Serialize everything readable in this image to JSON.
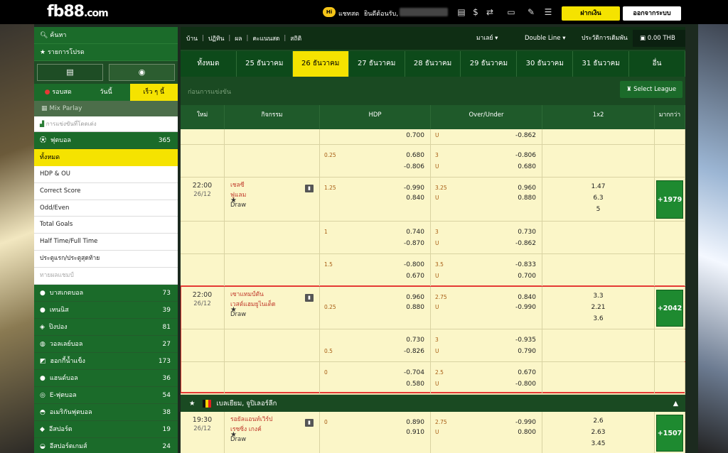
{
  "header": {
    "logo_main": "fb88",
    "logo_suffix": ".com",
    "chat_label": "แชทสด",
    "chat_badge": "Hi",
    "welcome": "ยินดีต้อนรับ,",
    "deposit_button": "ฝากเงิน",
    "logout_button": "ออกจากระบบ"
  },
  "sidebar": {
    "search": "ค้นหา",
    "favorites": "รายการโปรด",
    "tabs": [
      "รอบสด",
      "วันนี้",
      "เร็ว ๆ นี้"
    ],
    "mix_parlay": "Mix Parlay",
    "combo": "การแข่งขันที่โดดเด่ง",
    "football": {
      "label": "ฟุตบอล",
      "count": "365"
    },
    "all": "ทั้งหมด",
    "subs": [
      "HDP & OU",
      "Correct Score",
      "Odd/Even",
      "Total Goals",
      "Half Time/Full Time",
      "ประตูแรก/ประตูสุดท้าย",
      "ทายผลแชมป์"
    ],
    "sports": [
      {
        "label": "บาสเกตบอล",
        "count": "73"
      },
      {
        "label": "เทนนิส",
        "count": "39"
      },
      {
        "label": "ปิงปอง",
        "count": "81"
      },
      {
        "label": "วอลเลย์บอล",
        "count": "27"
      },
      {
        "label": "ฮอกกี้น้ำแข็ง",
        "count": "173"
      },
      {
        "label": "แฮนด์บอล",
        "count": "36"
      },
      {
        "label": "E-ฟุตบอล",
        "count": "54"
      },
      {
        "label": "อเมริกันฟุตบอล",
        "count": "38"
      },
      {
        "label": "อีสปอร์ต",
        "count": "19"
      },
      {
        "label": "อีสปอร์ตเกมส์",
        "count": "24"
      }
    ]
  },
  "nav": {
    "links": [
      "บ้าน",
      "ปฏิทิน",
      "ผล",
      "คะแนนสด",
      "สถิติ"
    ],
    "odds_type": "มาเลย์",
    "line": "Double Line",
    "history": "ประวัติการเดิมพัน",
    "balance": "0.00 THB"
  },
  "date_tabs": [
    "ทั้งหมด",
    "25 ธันวาคม",
    "26 ธันวาคม",
    "27 ธันวาคม",
    "28 ธันวาคม",
    "29 ธันวาคม",
    "30 ธันวาคม",
    "31 ธันวาคม",
    "อื่น"
  ],
  "section_title": "ก่อนการแข่งขัน",
  "select_league": "Select League",
  "columns": [
    "ใหม่",
    "กิจกรรม",
    "HDP",
    "Over/Under",
    "1x2",
    "มากกว่า"
  ],
  "rows": [
    {
      "h": 22,
      "hdp": {
        "l1": "",
        "v1": "0.700",
        "l2": "",
        "v2": ""
      },
      "ou": {
        "l1": "U",
        "v1": "-0.862",
        "l2": "",
        "v2": ""
      }
    },
    {
      "h": 46,
      "hdp": {
        "l1": "0.25",
        "v1": "0.680",
        "l2": "",
        "v2": "-0.806"
      },
      "ou": {
        "l1": "3",
        "v1": "-0.806",
        "l2": "U",
        "v2": "0.680"
      }
    },
    {
      "h": 62,
      "time": "22:00",
      "date": "26/12",
      "home": "เชลซี",
      "away": "ฟูแลม",
      "draw": "Draw",
      "hdp": {
        "l1": "1.25",
        "v1": "-0.990",
        "l2": "",
        "v2": "0.840"
      },
      "ou": {
        "l1": "3.25",
        "v1": "0.960",
        "l2": "U",
        "v2": "0.880"
      },
      "x12": [
        "1.47",
        "6.3",
        "5"
      ],
      "more": "+1979"
    },
    {
      "h": 46,
      "hdp": {
        "l1": "1",
        "v1": "0.740",
        "l2": "",
        "v2": "-0.870"
      },
      "ou": {
        "l1": "3",
        "v1": "0.730",
        "l2": "U",
        "v2": "-0.862"
      }
    },
    {
      "h": 46,
      "hdp": {
        "l1": "1.5",
        "v1": "-0.800",
        "l2": "",
        "v2": "0.670"
      },
      "ou": {
        "l1": "3.5",
        "v1": "-0.833",
        "l2": "U",
        "v2": "0.700"
      }
    },
    {
      "h": 60,
      "time": "22:00",
      "date": "26/12",
      "home": "เซาแทมป์ตัน",
      "away": "เวสต์แฮมยูไนเต็ด",
      "draw": "Draw",
      "hdp": {
        "l1": "",
        "v1": "0.960",
        "l2": "0.25",
        "v2": "0.880"
      },
      "ou": {
        "l1": "2.75",
        "v1": "0.840",
        "l2": "U",
        "v2": "-0.990"
      },
      "x12": [
        "3.3",
        "2.21",
        "3.6"
      ],
      "more": "+2042"
    },
    {
      "h": 46,
      "hdp": {
        "l1": "",
        "v1": "0.730",
        "l2": "0.5",
        "v2": "-0.826"
      },
      "ou": {
        "l1": "3",
        "v1": "-0.935",
        "l2": "U",
        "v2": "0.790"
      }
    },
    {
      "h": 46,
      "hdp": {
        "l1": "0",
        "v1": "-0.704",
        "l2": "",
        "v2": "0.580"
      },
      "ou": {
        "l1": "2.5",
        "v1": "0.670",
        "l2": "U",
        "v2": "-0.800"
      }
    }
  ],
  "league2": {
    "name": "เบลเยียม, จูปิเลอร์ลีก",
    "flag": [
      "#111111",
      "#f5d400",
      "#e02020"
    ]
  },
  "rows2": [
    {
      "h": 60,
      "time": "19:30",
      "date": "26/12",
      "home": "รอยัลแอนท์เวิร์ป",
      "away": "เรซซิ่ง เกงค์",
      "draw": "Draw",
      "hdp": {
        "l1": "0",
        "v1": "0.890",
        "l2": "",
        "v2": "0.910"
      },
      "ou": {
        "l1": "2.75",
        "v1": "-0.990",
        "l2": "U",
        "v2": "0.800"
      },
      "x12": [
        "2.6",
        "2.63",
        "3.45"
      ],
      "more": "+1507"
    }
  ]
}
